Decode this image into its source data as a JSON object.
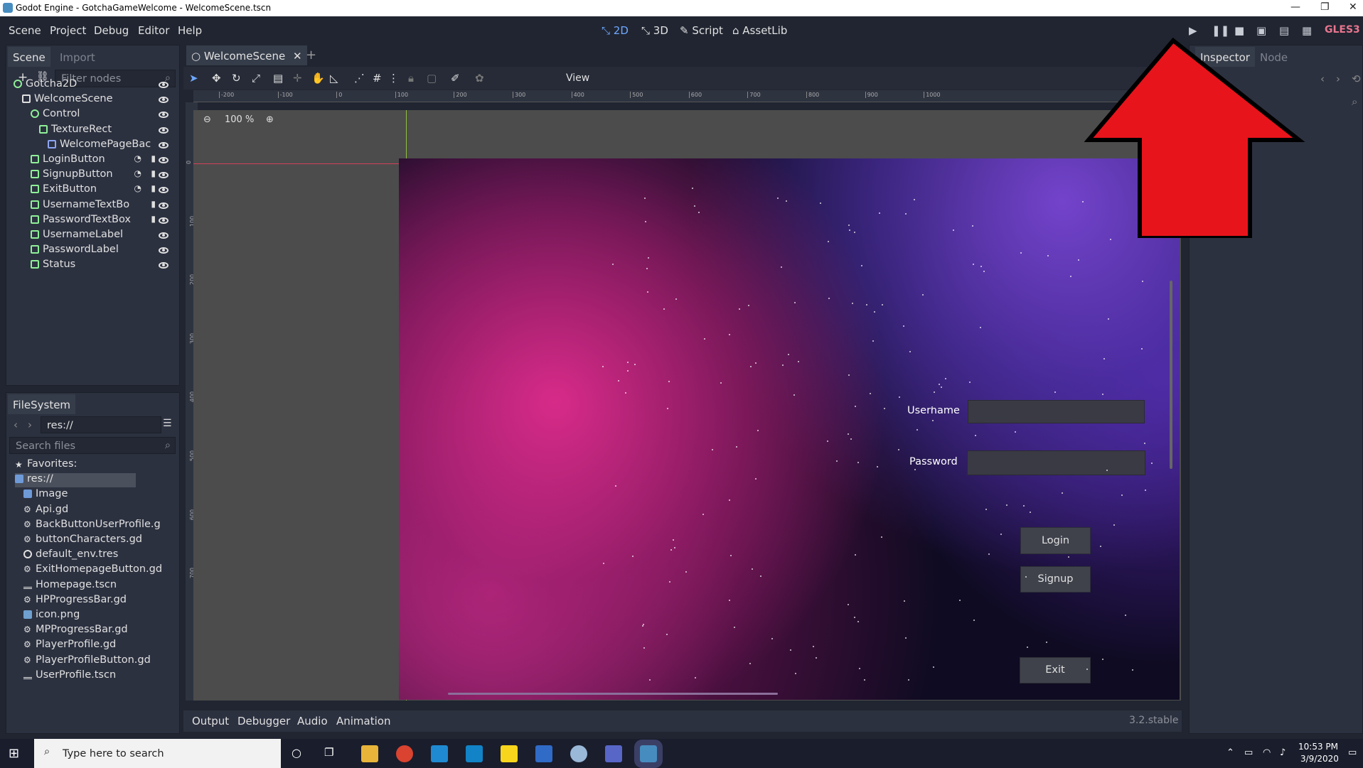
{
  "window": {
    "title": "Godot Engine - GotchaGameWelcome - WelcomeScene.tscn"
  },
  "menu": [
    "Scene",
    "Project",
    "Debug",
    "Editor",
    "Help"
  ],
  "modes": [
    "2D",
    "3D",
    "Script",
    "AssetLib"
  ],
  "renderer": "GLES3",
  "scene_dock": {
    "tabs": [
      "Scene",
      "Import"
    ],
    "filter_placeholder": "Filter nodes",
    "nodes": [
      {
        "label": "Gotcha2D",
        "depth": 0
      },
      {
        "label": "WelcomeScene",
        "depth": 1
      },
      {
        "label": "Control",
        "depth": 2
      },
      {
        "label": "TextureRect",
        "depth": 3
      },
      {
        "label": "WelcomePageBac",
        "depth": 4
      },
      {
        "label": "LoginButton",
        "depth": 2
      },
      {
        "label": "SignupButton",
        "depth": 2
      },
      {
        "label": "ExitButton",
        "depth": 2
      },
      {
        "label": "UsernameTextBo",
        "depth": 2
      },
      {
        "label": "PasswordTextBox",
        "depth": 2
      },
      {
        "label": "UsernameLabel",
        "depth": 2
      },
      {
        "label": "PasswordLabel",
        "depth": 2
      },
      {
        "label": "Status",
        "depth": 2
      }
    ]
  },
  "filesystem": {
    "tab": "FileSystem",
    "path": "res://",
    "search_placeholder": "Search files",
    "items": [
      "Favorites:",
      "res://",
      "Image",
      "Api.gd",
      "BackButtonUserProfile.g",
      "buttonCharacters.gd",
      "default_env.tres",
      "ExitHomepageButton.gd",
      "Homepage.tscn",
      "HPProgressBar.gd",
      "icon.png",
      "MPProgressBar.gd",
      "PlayerProfile.gd",
      "PlayerProfileButton.gd",
      "UserProfile.tscn"
    ]
  },
  "editor": {
    "scene_tab": "WelcomeScene",
    "view_menu": "View",
    "zoom": "100 %",
    "ruler_h": [
      "-200",
      "-100",
      "0",
      "100",
      "200",
      "300",
      "400",
      "500",
      "600",
      "700",
      "800",
      "900",
      "1000"
    ],
    "ruler_v": [
      "0",
      "100",
      "200",
      "300",
      "400",
      "500",
      "600",
      "700"
    ]
  },
  "scene": {
    "username_label": "Username",
    "password_label": "Password",
    "login": "Login",
    "signup": "Signup",
    "exit": "Exit"
  },
  "inspector": {
    "tabs": [
      "Inspector",
      "Node"
    ]
  },
  "bottom": {
    "tabs": [
      "Output",
      "Debugger",
      "Audio",
      "Animation"
    ],
    "version": "3.2.stable"
  },
  "taskbar": {
    "search_placeholder": "Type here to search",
    "time": "10:53 PM",
    "date": "3/9/2020"
  },
  "colors": {
    "accent": "#6fa8ff",
    "gles": "#e9758e",
    "arrow": "#e8141b"
  }
}
